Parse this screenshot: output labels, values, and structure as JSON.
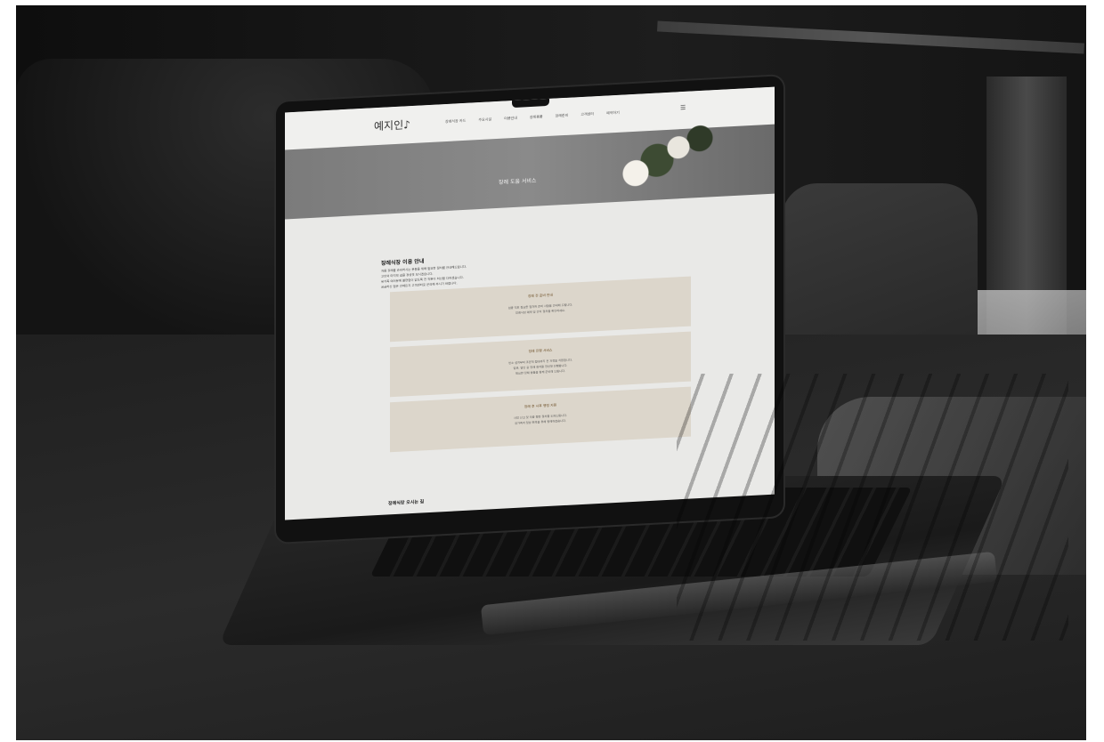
{
  "screen": {
    "logo": "예지인♪",
    "nav_items": [
      "장례식장 카드",
      "주요시설",
      "이용안내",
      "장례용품",
      "장례준비",
      "고객센터",
      "예약하기"
    ],
    "hero_title": "장례 도움 서비스",
    "intro_title": "장례식장 이용 안내",
    "intro_lines": [
      "처음 장례를 준비하시는 분들을 위해 필요한 절차를 안내해드립니다.",
      "고인의 마지막 길을 정성껏 모시겠습니다.",
      "유가족 여러분께 불편함이 없도록 전 직원이 최선을 다하겠습니다.",
      "궁금하신 점은 언제든지 고객센터로 문의해 주시기 바랍니다."
    ],
    "cards": [
      {
        "title": "장례 전 준비 안내",
        "lines": [
          "임종 직후 필요한 절차와 준비 사항을 안내해 드립니다.",
          "장례식장 예약 및 안치 절차를 확인하세요."
        ]
      },
      {
        "title": "장례 진행 서비스",
        "lines": [
          "빈소 설치부터 조문객 접대까지 전 과정을 지원합니다.",
          "입관, 발인 등 장례 절차를 정성껏 진행합니다.",
          "필요한 장례 용품을 함께 준비해 드립니다."
        ]
      },
      {
        "title": "장례 후 사후 행정 지원",
        "lines": [
          "사망 신고 및 각종 행정 절차를 도와드립니다.",
          "유가족의 일상 회복을 위해 함께하겠습니다."
        ]
      }
    ],
    "footer_title": "장례식장 오시는 길"
  },
  "colors": {
    "screen_bg": "#e9e9e7",
    "hero_bg": "#7b7b7b",
    "card_bg": "#dcd6cb",
    "card_title": "#6b4d24"
  }
}
